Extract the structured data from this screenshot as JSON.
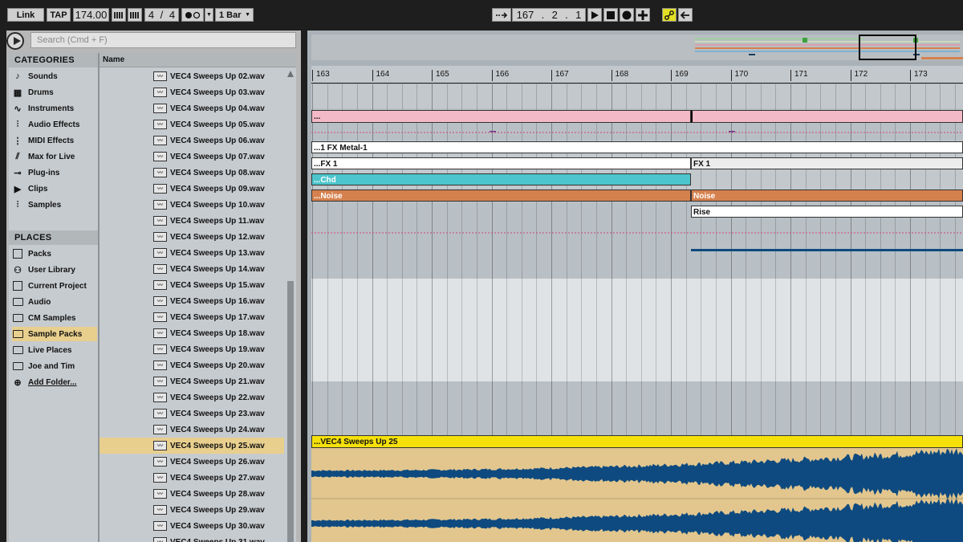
{
  "transport": {
    "link": "Link",
    "tap": "TAP",
    "tempo": "174.00",
    "sig_num": "4",
    "sig_den": "4",
    "quantize": "1 Bar",
    "position": {
      "bar": "167",
      "beat": "2",
      "sixteenth": "1"
    }
  },
  "browser": {
    "search_placeholder": "Search (Cmd + F)",
    "categories_title": "CATEGORIES",
    "places_title": "PLACES",
    "column_name": "Name",
    "categories": [
      {
        "label": "Sounds",
        "icon": "note-icon"
      },
      {
        "label": "Drums",
        "icon": "grid-icon"
      },
      {
        "label": "Instruments",
        "icon": "wave-icon"
      },
      {
        "label": "Audio Effects",
        "icon": "audio-fx-icon"
      },
      {
        "label": "MIDI Effects",
        "icon": "midi-fx-icon"
      },
      {
        "label": "Max for Live",
        "icon": "max-icon"
      },
      {
        "label": "Plug-ins",
        "icon": "plug-icon"
      },
      {
        "label": "Clips",
        "icon": "clip-icon"
      },
      {
        "label": "Samples",
        "icon": "sample-icon"
      }
    ],
    "places": [
      {
        "label": "Packs",
        "icon": "packs-icon"
      },
      {
        "label": "User Library",
        "icon": "user-icon"
      },
      {
        "label": "Current Project",
        "icon": "project-icon"
      },
      {
        "label": "Audio",
        "icon": "folder-icon"
      },
      {
        "label": "CM Samples",
        "icon": "folder-icon"
      },
      {
        "label": "Sample Packs",
        "icon": "folder-icon",
        "selected": true
      },
      {
        "label": "Live Places",
        "icon": "folder-icon"
      },
      {
        "label": "Joe and Tim",
        "icon": "folder-icon"
      },
      {
        "label": "Add Folder...",
        "icon": "add-icon"
      }
    ],
    "files": [
      "VEC4 Sweeps Up 02.wav",
      "VEC4 Sweeps Up 03.wav",
      "VEC4 Sweeps Up 04.wav",
      "VEC4 Sweeps Up 05.wav",
      "VEC4 Sweeps Up 06.wav",
      "VEC4 Sweeps Up 07.wav",
      "VEC4 Sweeps Up 08.wav",
      "VEC4 Sweeps Up 09.wav",
      "VEC4 Sweeps Up 10.wav",
      "VEC4 Sweeps Up 11.wav",
      "VEC4 Sweeps Up 12.wav",
      "VEC4 Sweeps Up 13.wav",
      "VEC4 Sweeps Up 14.wav",
      "VEC4 Sweeps Up 15.wav",
      "VEC4 Sweeps Up 16.wav",
      "VEC4 Sweeps Up 17.wav",
      "VEC4 Sweeps Up 18.wav",
      "VEC4 Sweeps Up 19.wav",
      "VEC4 Sweeps Up 20.wav",
      "VEC4 Sweeps Up 21.wav",
      "VEC4 Sweeps Up 22.wav",
      "VEC4 Sweeps Up 23.wav",
      "VEC4 Sweeps Up 24.wav",
      "VEC4 Sweeps Up 25.wav",
      "VEC4 Sweeps Up 26.wav",
      "VEC4 Sweeps Up 27.wav",
      "VEC4 Sweeps Up 28.wav",
      "VEC4 Sweeps Up 29.wav",
      "VEC4 Sweeps Up 30.wav",
      "VEC4 Sweeps Up 31.wav"
    ],
    "selected_file": "VEC4 Sweeps Up 25.wav"
  },
  "arrangement": {
    "bars": [
      "163",
      "164",
      "165",
      "166",
      "167",
      "168",
      "169",
      "170",
      "171",
      "172",
      "173"
    ],
    "clips": {
      "pink_a": "...",
      "fx_metal": "...1 FX Metal-1",
      "fx1_a": "...FX 1",
      "fx1_b": "FX 1",
      "chd": "...Chd",
      "noise_a": "...Noise",
      "noise_b": "Noise",
      "rise": "Rise",
      "sweep": "...VEC4 Sweeps Up 25"
    },
    "colors": {
      "pink": "#f4b9c6",
      "teal": "#4cc5cc",
      "orange": "#d5814e",
      "yellow": "#f5e00a",
      "wave_bg": "#e2c68e",
      "wave": "#0e4a7f",
      "accent_yellow": "#e3e024"
    }
  }
}
